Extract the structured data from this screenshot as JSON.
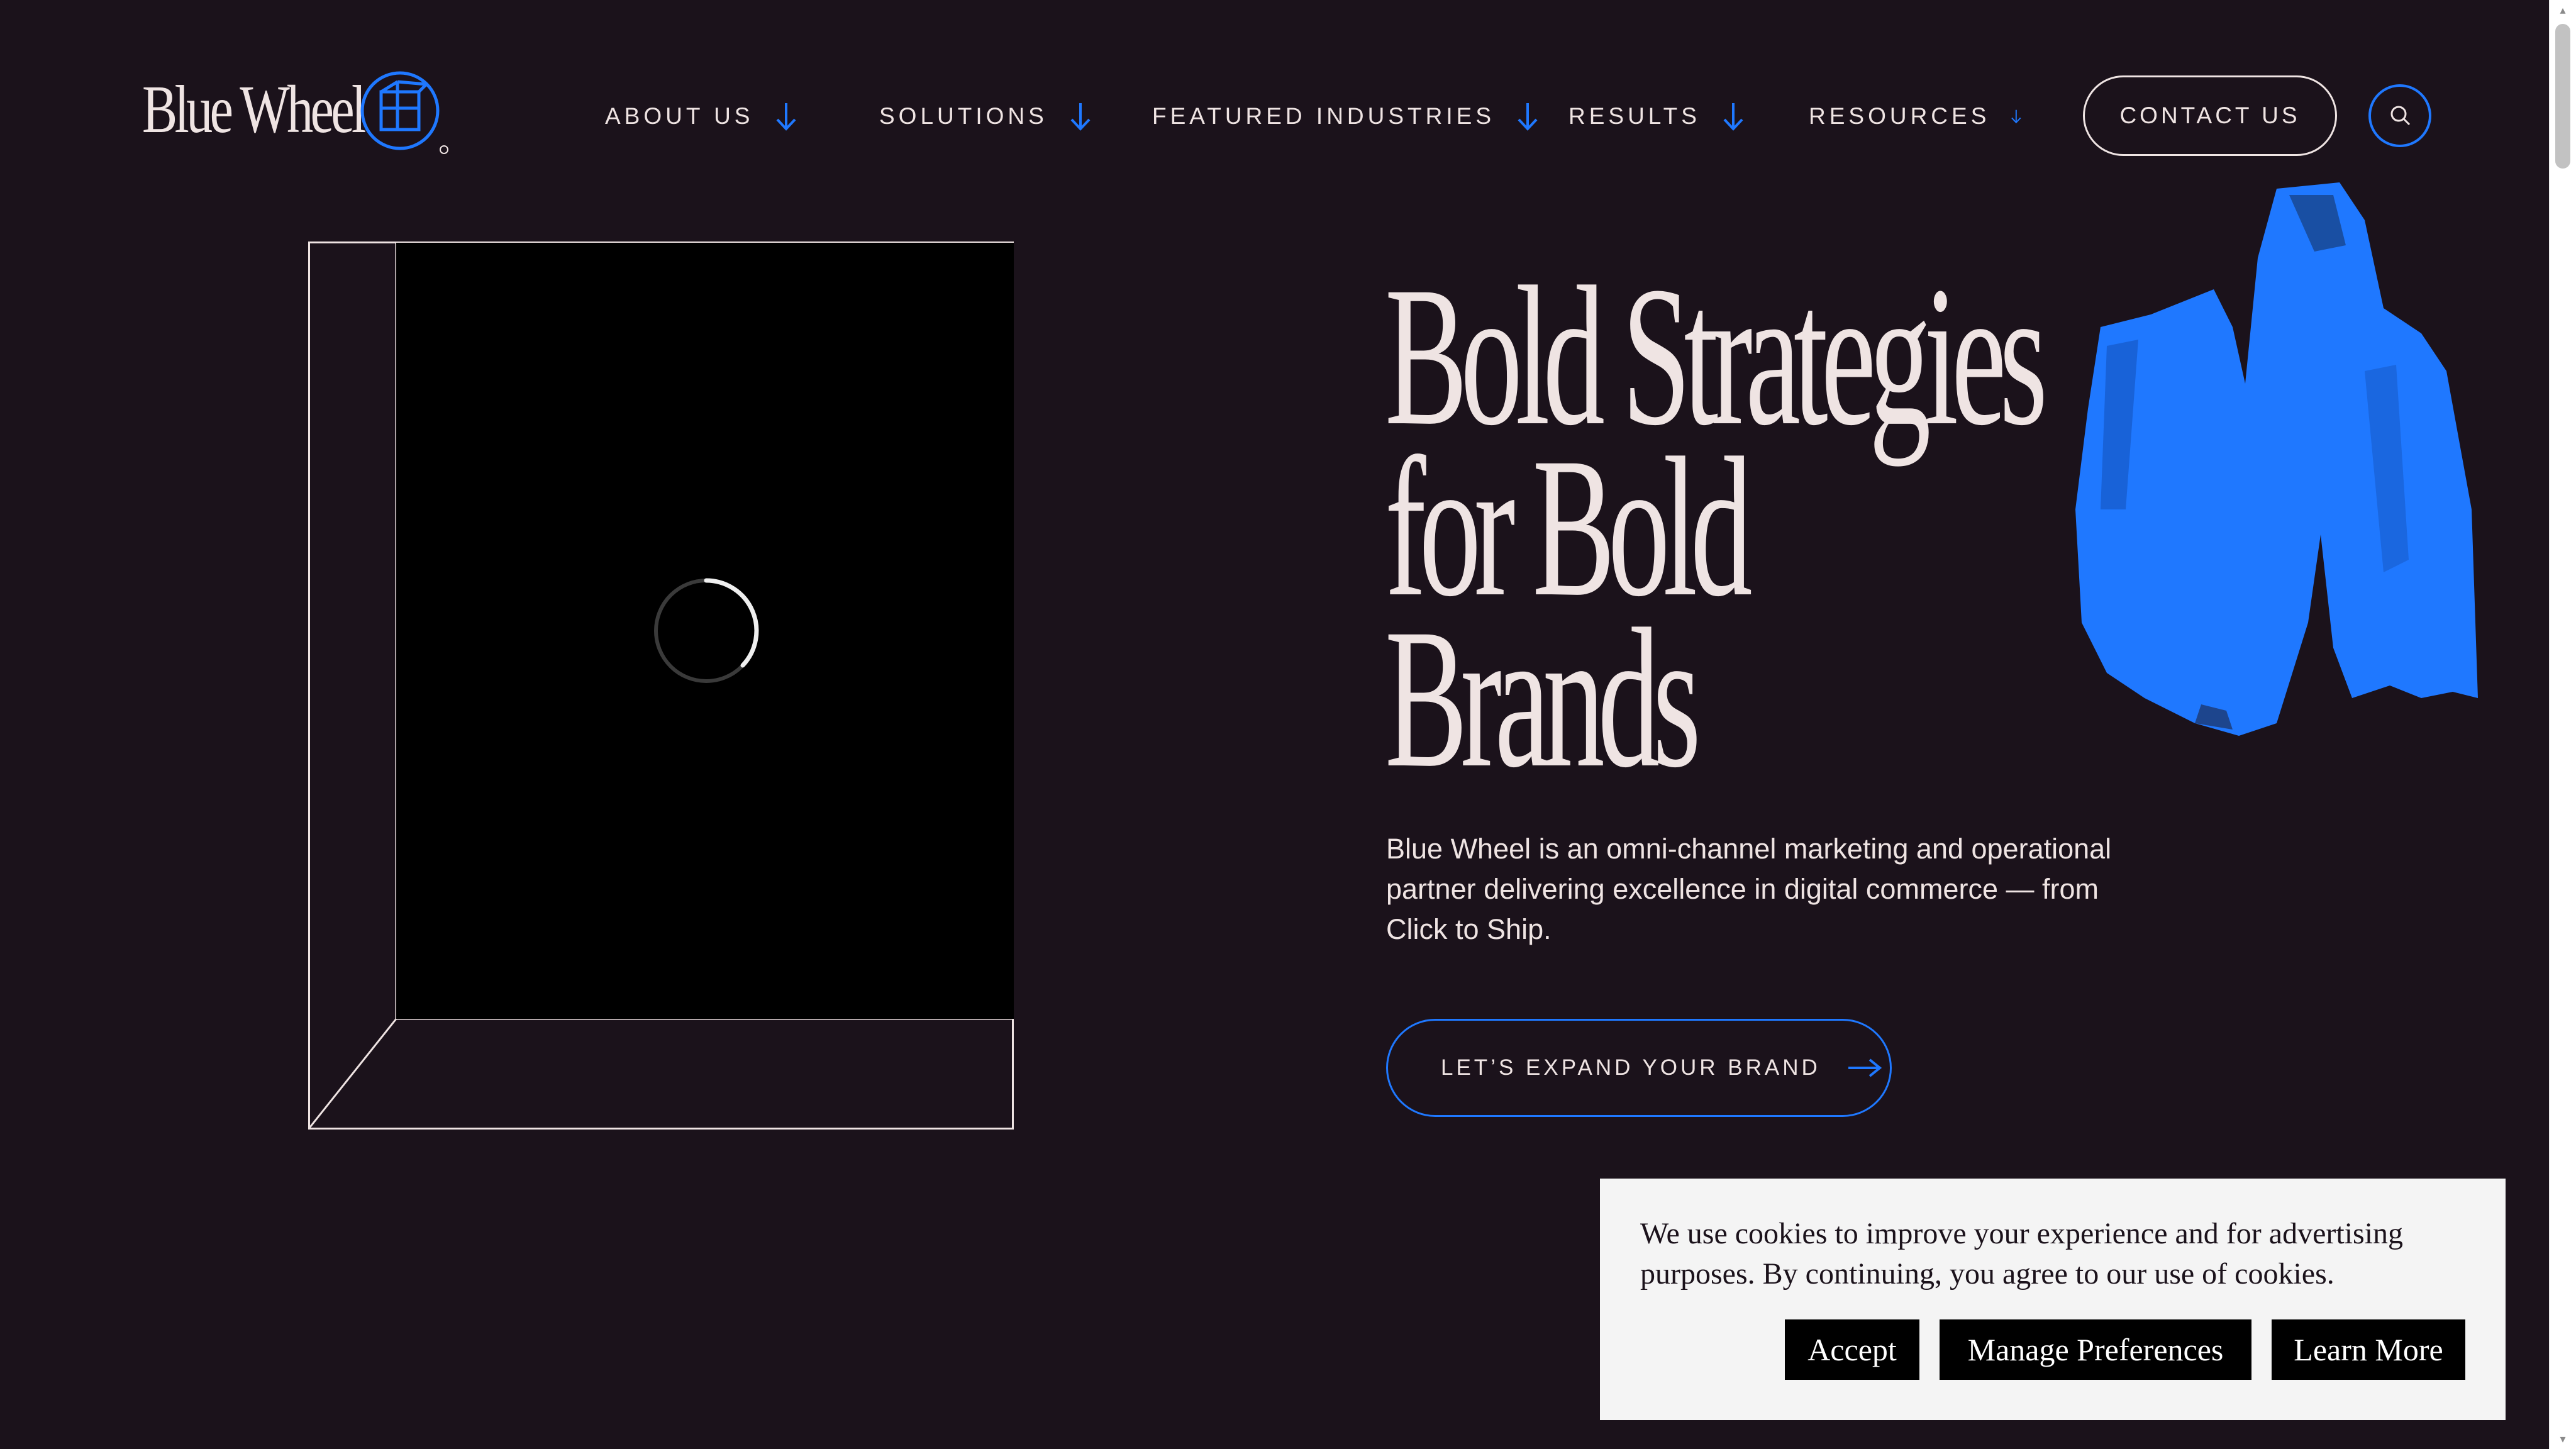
{
  "header": {
    "logo_text": "Blue Wheel",
    "nav": [
      {
        "label": "ABOUT US"
      },
      {
        "label": "SOLUTIONS"
      },
      {
        "label": "FEATURED INDUSTRIES"
      },
      {
        "label": "RESULTS"
      },
      {
        "label": "RESOURCES"
      }
    ],
    "contact_label": "CONTACT US",
    "search_icon": "search-icon"
  },
  "hero": {
    "headline": [
      "Bold Strategies",
      "for Bold",
      "Brands"
    ],
    "subtext": "Blue Wheel is an omni-channel marketing and operational partner delivering excellence in digital commerce — from Click to Ship.",
    "cta_label": "LET’S EXPAND YOUR BRAND",
    "video_state": "loading"
  },
  "cookie_banner": {
    "text": "We use cookies to improve your experience and for advertising purposes. By continuing, you agree to our use of cookies.",
    "buttons": {
      "accept": "Accept",
      "manage": "Manage Preferences",
      "learn": "Learn More"
    }
  },
  "colors": {
    "background": "#1b121b",
    "text": "#efe4e3",
    "accent_blue": "#1f78ff",
    "banner_bg": "#f4f4f4",
    "banner_button": "#000000"
  }
}
